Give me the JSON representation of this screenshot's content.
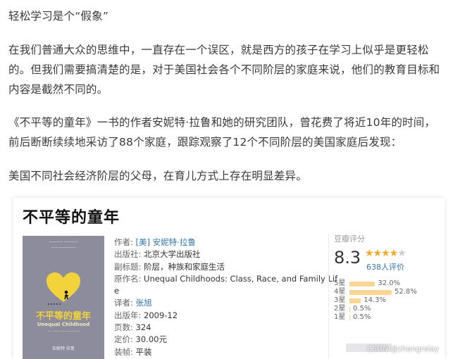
{
  "article": {
    "title": "轻松学习是个“假象”",
    "paragraph1": "在我们普通大众的思维中，一直存在一个误区，就是西方的孩子在学习上似乎是更轻松的。但我们需要搞清楚的是，对于美国社会各个不同阶层的家庭来说，他们的教育目标和内容是截然不同的。",
    "paragraph2": "《不平等的童年》一书的作者安妮特·拉鲁和她的研究团队，曾花费了将近10年的时间，前后断断续续地采访了88个家庭，跟踪观察了12个不同阶层的美国家庭后发现：",
    "paragraph3": "美国不同社会经济阶层的父母，在育儿方式上存在明显差异。"
  },
  "book": {
    "title": "不平等的童年",
    "cover": {
      "top_line1": "一一一一 一一一一",
      "top_line2": "一一一一一一一",
      "title_cn": "不平等的童年",
      "title_en": "Unequal Childhood",
      "subtitle": "─── ──── ─── ──── ───",
      "author": "安妮特·拉鲁",
      "bg_color": "#8c8c9c",
      "heart_color": "#f2d33b"
    },
    "info": {
      "author_label": "作者:",
      "author_value": "[美] 安妮特·拉鲁",
      "publisher_label": "出版社:",
      "publisher_value": "北京大学出版社",
      "subtitle_label": "副标题:",
      "subtitle_value": "阶层，种族和家庭生活",
      "original_label": "原作名:",
      "original_value": "Unequal Childhoods: Class, Race, and Family Lif",
      "original_value_wrap": "e",
      "translator_label": "译者:",
      "translator_value": "张旭",
      "date_label": "出版年:",
      "date_value": "2009-12",
      "pages_label": "页数:",
      "pages_value": "324",
      "price_label": "定价:",
      "price_value": "30.00元",
      "binding_label": "装帧:",
      "binding_value": "平装"
    },
    "rating": {
      "header": "豆瓣评分",
      "score": "8.3",
      "stars_filled": "★★★★",
      "stars_empty": "★",
      "count": "638人评价",
      "distribution": [
        {
          "label": "5星",
          "pct": "32.0%",
          "value": 32.0
        },
        {
          "label": "4星",
          "pct": "52.8%",
          "value": 52.8
        },
        {
          "label": "3星",
          "pct": "14.3%",
          "value": 14.3
        },
        {
          "label": "2星",
          "pct": "0.5%",
          "value": 0.5
        },
        {
          "label": "1星",
          "pct": "0.5%",
          "value": 0.5
        }
      ]
    },
    "watermark": "CSDN @zhengrelay"
  }
}
